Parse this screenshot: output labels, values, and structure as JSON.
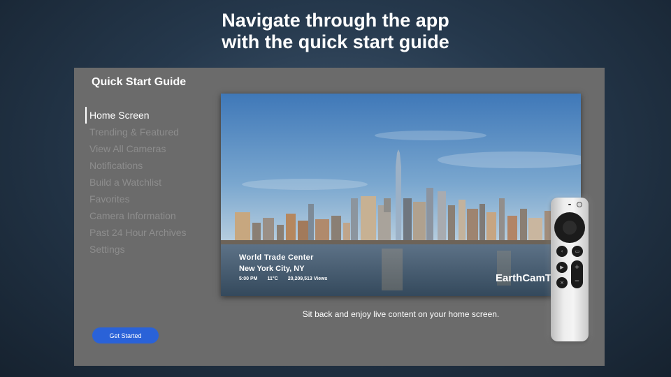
{
  "headline": {
    "line1": "Navigate through the app",
    "line2": "with the quick start guide"
  },
  "panel": {
    "title": "Quick Start Guide",
    "menu": [
      {
        "label": "Home Screen",
        "active": true
      },
      {
        "label": "Trending & Featured",
        "active": false
      },
      {
        "label": "View All Cameras",
        "active": false
      },
      {
        "label": "Notifications",
        "active": false
      },
      {
        "label": "Build a Watchlist",
        "active": false
      },
      {
        "label": "Favorites",
        "active": false
      },
      {
        "label": "Camera Information",
        "active": false
      },
      {
        "label": "Past 24 Hour Archives",
        "active": false
      },
      {
        "label": "Settings",
        "active": false
      }
    ],
    "preview": {
      "location_title": "World Trade Center",
      "location_sub": "New York City, NY",
      "time": "5:00 PM",
      "temperature": "11°C",
      "views": "20,209,513 Views",
      "watermark": "EarthCamTV"
    },
    "caption": "Sit back and enjoy live content on your home screen.",
    "cta_label": "Get Started"
  },
  "remote": {
    "icons": [
      "power-icon",
      "back-icon",
      "tv-icon",
      "play-pause-icon",
      "mute-icon",
      "plus-icon",
      "minus-icon"
    ]
  },
  "colors": {
    "panel": "#6b6b6b",
    "accent": "#2a62d8",
    "menu_inactive": "#8d8d8d",
    "menu_active": "#ffffff"
  }
}
